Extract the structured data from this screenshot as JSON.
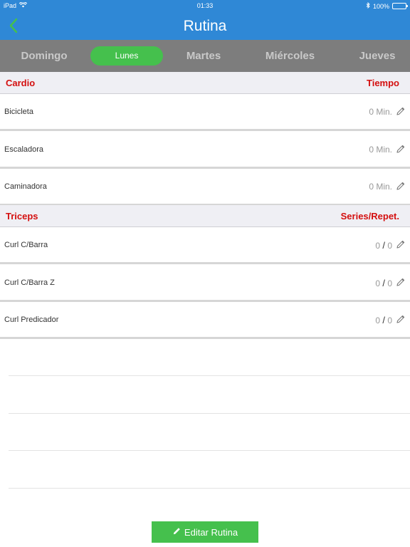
{
  "status_bar": {
    "device": "iPad",
    "time": "01:33",
    "battery": "100%"
  },
  "nav": {
    "title": "Rutina",
    "back_icon": "chevron-left-icon"
  },
  "day_tabs": [
    {
      "label": "Domingo",
      "active": false
    },
    {
      "label": "Lunes",
      "active": true
    },
    {
      "label": "Martes",
      "active": false
    },
    {
      "label": "Miércoles",
      "active": false
    },
    {
      "label": "Jueves",
      "active": false
    }
  ],
  "sections": [
    {
      "title": "Cardio",
      "right_label": "Tiempo",
      "rows": [
        {
          "name": "Bicicleta",
          "value": "0 Min."
        },
        {
          "name": "Escaladora",
          "value": "0 Min."
        },
        {
          "name": "Caminadora",
          "value": "0 Min."
        }
      ]
    },
    {
      "title": "Triceps",
      "right_label": "Series/Repet.",
      "rows": [
        {
          "name": "Curl C/Barra",
          "series": "0",
          "separator": "/",
          "reps": "0"
        },
        {
          "name": "Curl C/Barra Z",
          "series": "0",
          "separator": "/",
          "reps": "0"
        },
        {
          "name": "Curl Predicador",
          "series": "0",
          "separator": "/",
          "reps": "0"
        }
      ]
    }
  ],
  "edit_button": {
    "label": "Editar Rutina",
    "icon": "pencil-icon"
  },
  "colors": {
    "nav_blue": "#2f88d6",
    "tab_bar_gray": "#7d7d7d",
    "active_green": "#45c04d",
    "section_red": "#d40f0f"
  }
}
